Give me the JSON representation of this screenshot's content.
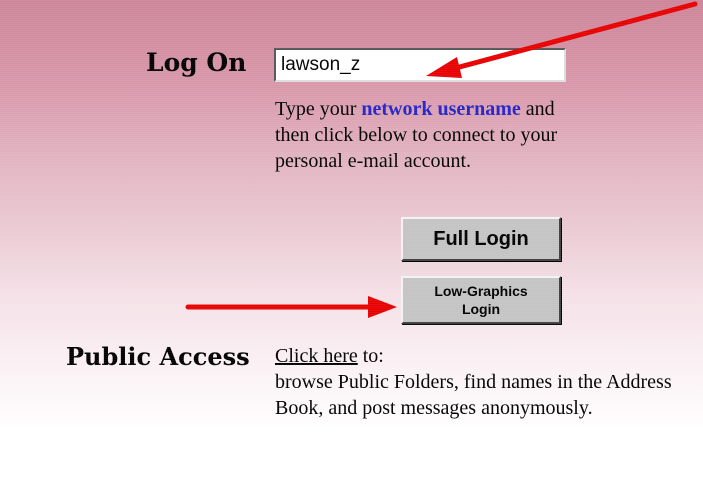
{
  "logon": {
    "label": "Log On",
    "username_value": "lawson_z",
    "instructions_before": "Type your ",
    "instructions_link": "network username",
    "instructions_after": " and then click below to connect to your personal e-mail account."
  },
  "buttons": {
    "full_login": "Full Login",
    "low_graphics_line1": "Low-Graphics",
    "low_graphics_line2": "Login"
  },
  "public_access": {
    "label": "Public Access",
    "link_text": "Click here",
    "after_link": " to:",
    "description": "browse Public Folders, find names in the Address Book, and post messages anonymously."
  },
  "colors": {
    "arrow": "#e60000",
    "link": "#2323c8",
    "button_face": "#c4c4c4"
  }
}
